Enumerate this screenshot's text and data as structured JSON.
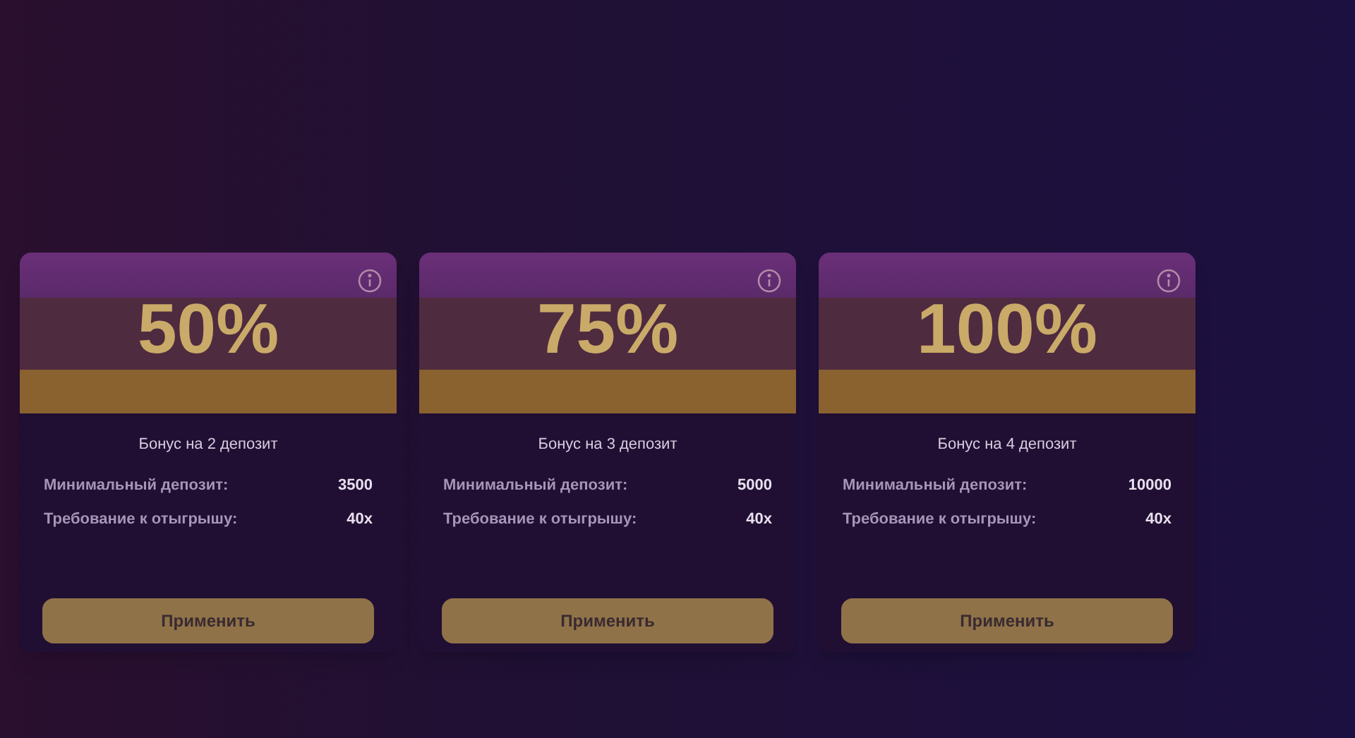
{
  "bonuses": [
    {
      "percent": "50%",
      "title": "Бонус на 2 депозит",
      "rows": [
        {
          "label": "Минимальный депозит:",
          "value": "3500"
        },
        {
          "label": "Требование к отыгрышу:",
          "value": "40x"
        }
      ],
      "button": "Применить"
    },
    {
      "percent": "75%",
      "title": "Бонус на 3 депозит",
      "rows": [
        {
          "label": "Минимальный депозит:",
          "value": "5000"
        },
        {
          "label": "Требование к отыгрышу:",
          "value": "40x"
        }
      ],
      "button": "Применить"
    },
    {
      "percent": "100%",
      "title": "Бонус на 4 депозит",
      "rows": [
        {
          "label": "Минимальный депозит:",
          "value": "10000"
        },
        {
          "label": "Требование к отыгрышу:",
          "value": "40x"
        }
      ],
      "button": "Применить"
    }
  ]
}
